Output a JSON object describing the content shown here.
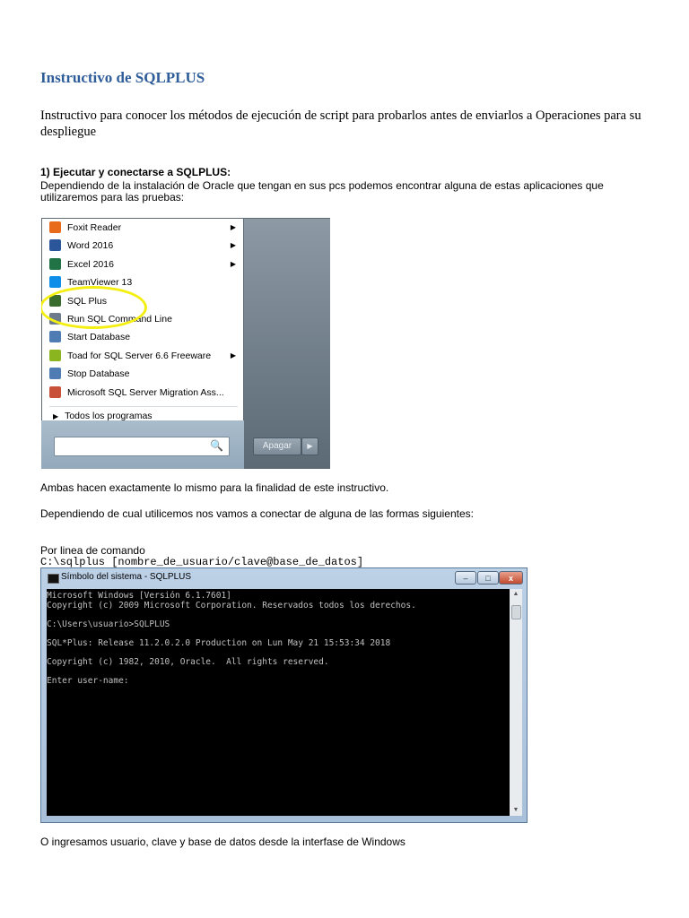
{
  "document": {
    "title": "Instructivo de SQLPLUS",
    "intro": "Instructivo para conocer los métodos de ejecución de script para probarlos antes de enviarlos a Operaciones para su despliegue",
    "section1_heading": "1) Ejecutar y conectarse a SQLPLUS:",
    "section1_body": "Dependiendo de la instalación de Oracle que tengan en sus pcs podemos encontrar alguna de estas aplicaciones que utilizaremos para las pruebas:",
    "para_both": "Ambas hacen exactamente lo mismo para la finalidad de este instructivo.",
    "para_connect": "Dependiendo de cual utilicemos nos vamos a conectar de alguna de las formas siguientes:",
    "by_command_line": "Por linea de comando",
    "command_syntax": "C:\\sqlplus [nombre_de_usuario/clave@base_de_datos]",
    "closing": "O ingresamos usuario, clave y base de datos desde la interfase de Windows"
  },
  "start_menu": {
    "items": [
      {
        "label": "Foxit Reader",
        "icon": "foxit-icon",
        "color": "#e86a1b",
        "arrow": "▶"
      },
      {
        "label": "Word 2016",
        "icon": "word-icon",
        "color": "#2b579a",
        "arrow": "▶"
      },
      {
        "label": "Excel 2016",
        "icon": "excel-icon",
        "color": "#217346",
        "arrow": "▶"
      },
      {
        "label": "TeamViewer 13",
        "icon": "teamviewer-icon",
        "color": "#0e8ee9",
        "arrow": ""
      },
      {
        "label": "SQL Plus",
        "icon": "sqlplus-icon",
        "color": "#3a6b2e",
        "arrow": ""
      },
      {
        "label": "Run SQL Command Line",
        "icon": "sql-command-line-icon",
        "color": "#6d7b8c",
        "arrow": ""
      },
      {
        "label": "Start Database",
        "icon": "start-database-icon",
        "color": "#4f7cb3",
        "arrow": ""
      },
      {
        "label": "Toad for SQL Server 6.6 Freeware",
        "icon": "toad-icon",
        "color": "#8ab51e",
        "arrow": "▶"
      },
      {
        "label": "Stop Database",
        "icon": "stop-database-icon",
        "color": "#4f7cb3",
        "arrow": ""
      },
      {
        "label": "Microsoft SQL Server Migration Ass...",
        "icon": "migration-assistant-icon",
        "color": "#c8513a",
        "arrow": ""
      }
    ],
    "all_programs": "Todos los programas",
    "all_programs_arrow": "▶",
    "search_placeholder": "",
    "search_icon": "🔍",
    "shutdown_label": "Apagar",
    "shutdown_arrow": "▶",
    "highlight_color": "#f4ef10"
  },
  "console": {
    "title": "Símbolo del sistema - SQLPLUS",
    "minimize": "–",
    "maximize": "□",
    "close": "x",
    "lines": [
      "Microsoft Windows [Versión 6.1.7601]",
      "Copyright (c) 2009 Microsoft Corporation. Reservados todos los derechos.",
      "",
      "C:\\Users\\usuario>SQLPLUS",
      "",
      "SQL*Plus: Release 11.2.0.2.0 Production on Lun May 21 15:53:34 2018",
      "",
      "Copyright (c) 1982, 2010, Oracle.  All rights reserved.",
      "",
      "Enter user-name:"
    ],
    "scroll_up": "▲",
    "scroll_down": "▼"
  }
}
